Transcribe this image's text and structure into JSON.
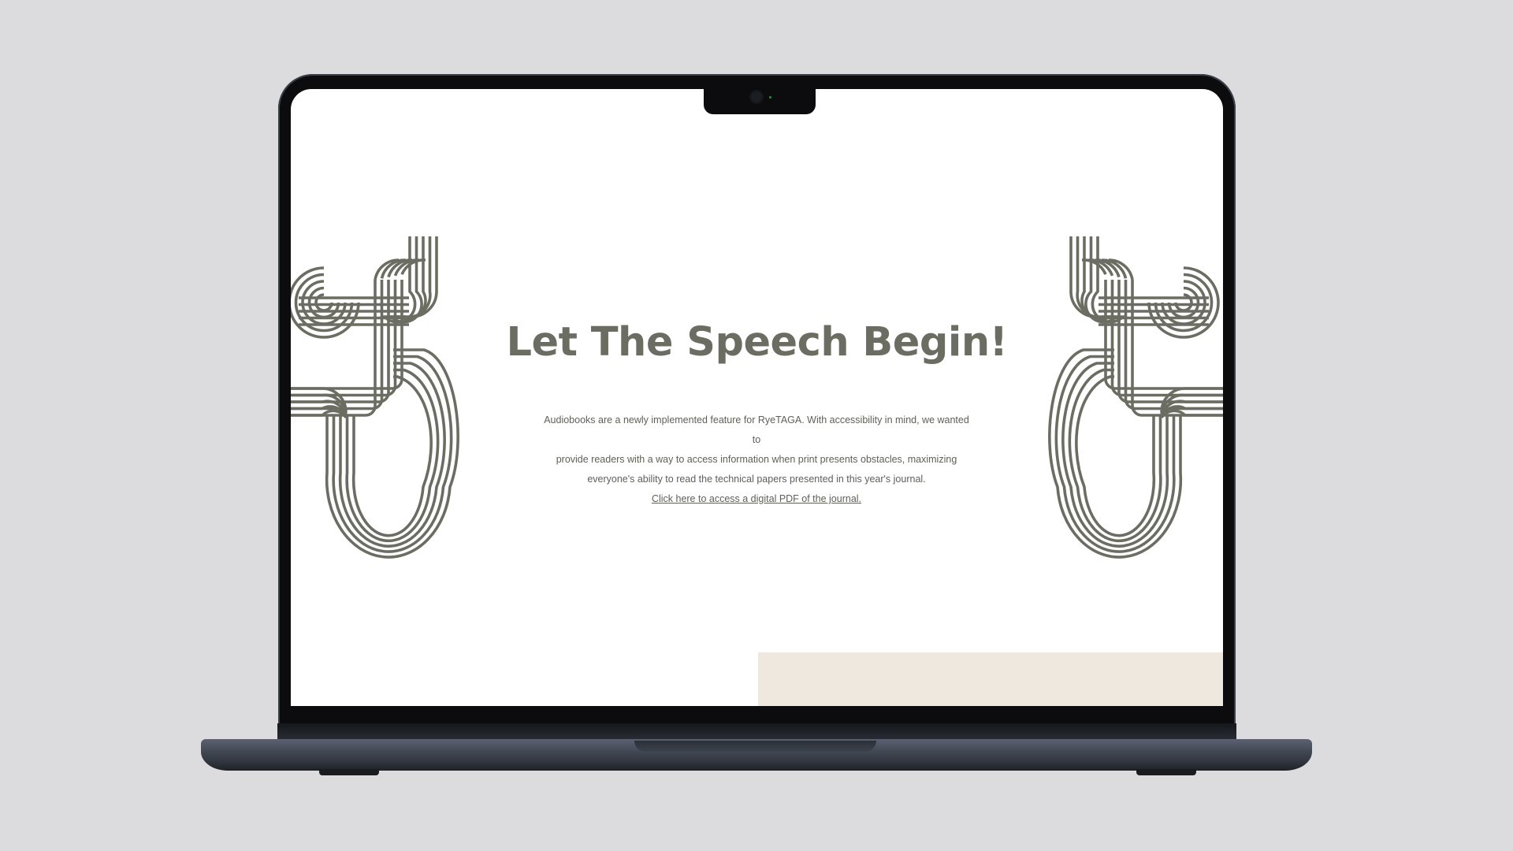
{
  "hero": {
    "title": "Let The Speech Begin!",
    "body_lines": [
      "Audiobooks are a newly implemented feature for RyeTAGA. With accessibility in mind, we wanted to",
      "provide readers with a way to access information when print presents obstacles, maximizing",
      "everyone's ability to read the technical papers presented in this year's journal."
    ],
    "link_text": "Click here to access a digital PDF of the journal."
  },
  "colors": {
    "accent": "#6c6d62",
    "body_text": "#5f6058",
    "page_background": "#dcdcde",
    "screen_background": "#ffffff",
    "panel_beige": "#efe8de"
  },
  "icons": {
    "decor_left": "knot-ornament",
    "decor_right": "knot-ornament"
  }
}
